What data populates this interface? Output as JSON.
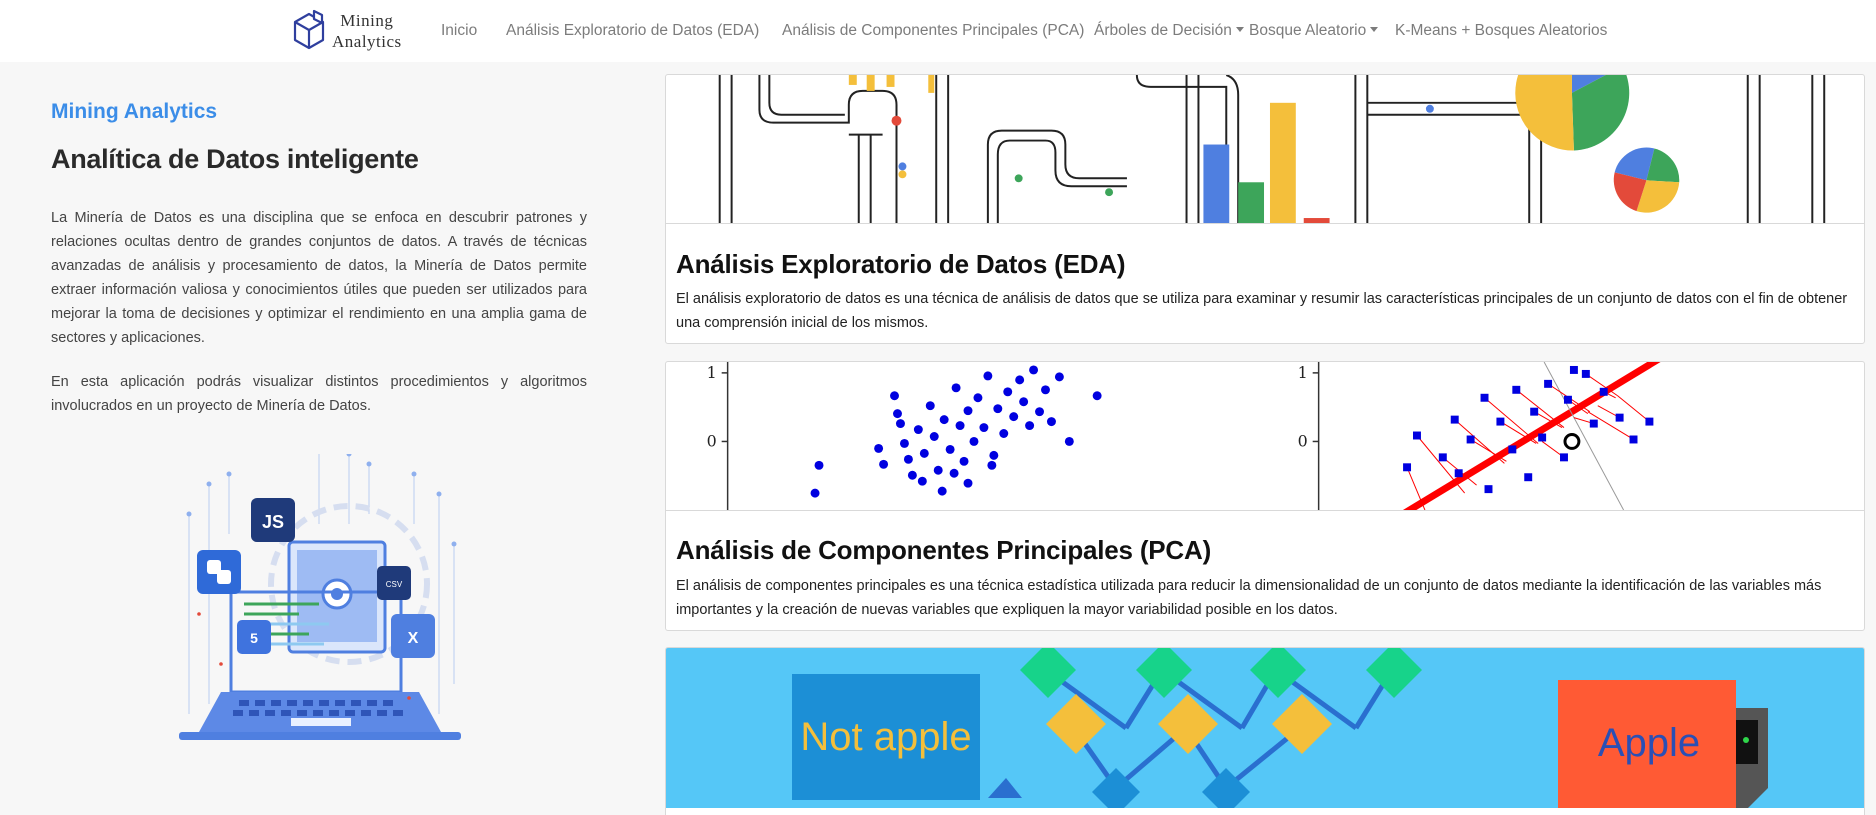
{
  "brand": {
    "line1": "Mining",
    "line2": "Analytics",
    "logo_icon": "cube-logo-icon"
  },
  "nav": {
    "items": [
      {
        "label": "Inicio",
        "dropdown": false
      },
      {
        "label": "Análisis Exploratorio de Datos (EDA)",
        "dropdown": false
      },
      {
        "label": "Análisis de Componentes Principales (PCA)",
        "dropdown": false
      },
      {
        "label": "Árboles de Decisión",
        "dropdown": true
      },
      {
        "label": "Bosque Aleatorio",
        "dropdown": true
      },
      {
        "label": "K-Means + Bosques Aleatorios",
        "dropdown": false
      }
    ]
  },
  "intro": {
    "kicker": "Mining Analytics",
    "headline": "Analítica de Datos inteligente",
    "paragraph1": "La Minería de Datos es una disciplina que se enfoca en descubrir patrones y relaciones ocultas dentro de grandes conjuntos de datos. A través de técnicas avanzadas de análisis y procesamiento de datos, la Minería de Datos permite extraer información valiosa y conocimientos útiles que pueden ser utilizados para mejorar la toma de decisiones y optimizar el rendimiento en una amplia gama de sectores y aplicaciones.",
    "paragraph2": "En esta aplicación podrás visualizar distintos procedimientos y algoritmos involucrados en un proyecto de Minería de Datos.",
    "illustration": {
      "js_badge": "JS",
      "html_badge": "5",
      "csv_badge": "CSV",
      "excel_badge": "X"
    }
  },
  "cards": [
    {
      "title": "Análisis Exploratorio de Datos (EDA)",
      "text": "El análisis exploratorio de datos es una técnica de análisis de datos que se utiliza para examinar y resumir las características principales de un conjunto de datos con el fin de obtener una comprensión inicial de los mismos."
    },
    {
      "title": "Análisis de Componentes Principales (PCA)",
      "text": "El análisis de componentes principales es una técnica estadística utilizada para reducir la dimensionalidad de un conjunto de datos mediante la identificación de las variables más importantes y la creación de nuevas variables que expliquen la mayor variabilidad posible en los datos.",
      "axis_ticks": [
        "1",
        "0",
        "1",
        "0"
      ]
    },
    {
      "left_label": "Not apple",
      "right_label": "Apple"
    }
  ],
  "colors": {
    "kicker": "#3b8de8",
    "blue": "#4f7fe0",
    "green": "#3da55a",
    "yellow": "#f4bf3b",
    "red": "#e34a3a",
    "sky": "#55c7f7",
    "teal": "#17d38a"
  }
}
